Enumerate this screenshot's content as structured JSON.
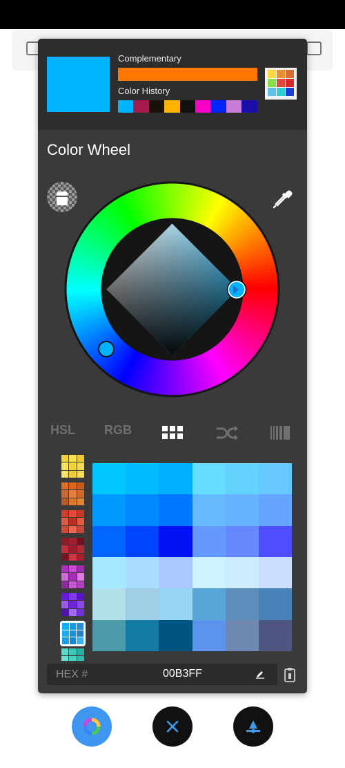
{
  "panel": {
    "complementary_label": "Complementary",
    "history_label": "Color History",
    "section_title": "Color Wheel",
    "current_color": "#00B3FF",
    "complementary_color": "#FF7700",
    "history_colors": [
      "#00B3FF",
      "#A51B4E",
      "#1A1208",
      "#FFB300",
      "#111111",
      "#FF00C8",
      "#0025FF",
      "#C87CD8",
      "#1C0FA8"
    ],
    "palette_preview": [
      "#ffd83b",
      "#e89031",
      "#d86c33",
      "#8be04a",
      "#e0483c",
      "#d62a2a",
      "#5ec2ea",
      "#2ed0d6",
      "#1a3fd9"
    ]
  },
  "tabs": {
    "hsl": "HSL",
    "rgb": "RGB"
  },
  "side_palettes": [
    [
      "#f3d23a",
      "#f6e04a",
      "#f0cb2f",
      "#f7e05c",
      "#f0d23c",
      "#f5dc56",
      "#f8e26c",
      "#eecd39",
      "#f5dd5a"
    ],
    [
      "#e0701f",
      "#d9661a",
      "#c85a1a",
      "#c86a32",
      "#e3813c",
      "#d06a25",
      "#b85a24",
      "#d8792e",
      "#e08533"
    ],
    [
      "#d43a2a",
      "#e04a36",
      "#c9362a",
      "#dd5b46",
      "#b92f24",
      "#e35a40",
      "#cf4a36",
      "#e86a52",
      "#c94536"
    ],
    [
      "#8e1a2a",
      "#a0222f",
      "#6e1020",
      "#c22d3a",
      "#9b1e2e",
      "#b42838",
      "#7a1424",
      "#cf3642",
      "#a6202f"
    ],
    [
      "#b02fc0",
      "#c94bd4",
      "#9a2aa8",
      "#d06ad8",
      "#a52eb6",
      "#e07ae2",
      "#8c2a9e",
      "#c65bd0",
      "#b63ec2"
    ],
    [
      "#6a1ae0",
      "#7e3ae8",
      "#5a14c8",
      "#9a5af0",
      "#6e24d8",
      "#8a48e6",
      "#4e12b0",
      "#a06af2",
      "#7430d8"
    ],
    [
      "#00b3ff",
      "#00a0ea",
      "#2b8fd8",
      "#16aaf2",
      "#0b94e0",
      "#2a7ec8",
      "#1c9fe6",
      "#0f88d2",
      "#3ab4f0"
    ],
    [
      "#5ad8c8",
      "#3ec8b8",
      "#2ab0a2",
      "#6ae0d2",
      "#48d0c0",
      "#32baa8",
      "#7ae8d8",
      "#56d6c6",
      "#40c2b2"
    ]
  ],
  "grid_colors": [
    "#00C8FF",
    "#00BBFF",
    "#00B0FF",
    "#66DCFF",
    "#62D3FF",
    "#66C8FF",
    "#0099FF",
    "#0088FF",
    "#0077FF",
    "#66BBFF",
    "#66B3FF",
    "#66A5FF",
    "#0066FF",
    "#0044FF",
    "#0011F5",
    "#6699FF",
    "#6688FF",
    "#4E4EFF",
    "#A6E8FF",
    "#A8DDFF",
    "#A8C8FF",
    "#CCF3FF",
    "#CDEBFF",
    "#CCDDFF",
    "#B3DFEA",
    "#A0CFE5",
    "#99D3F2",
    "#58A6D9",
    "#5B8FBA",
    "#4682B8",
    "#4C9BAA",
    "#147BA6",
    "#005580",
    "#5C93EC",
    "#6F88B0",
    "#4D5580"
  ],
  "hex": {
    "label": "HEX #",
    "value": "00B3FF"
  },
  "fab_colors": {
    "wheel": "#3f96f0",
    "close": "#111111",
    "picker": "#111111"
  }
}
